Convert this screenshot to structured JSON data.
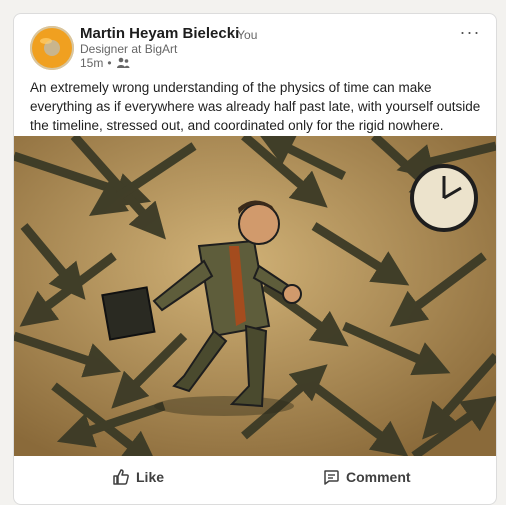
{
  "post": {
    "author_name": "Martin Heyam Bielecki",
    "you_tag": "· You",
    "headline": "Designer at BigArt",
    "time": "15m",
    "dot": "•",
    "visibility_icon": "connections-icon",
    "more_icon": "ellipsis-icon",
    "more_label": "···",
    "text": "An extremely wrong understanding of the physics of time can make everything as if everywhere was already half past late, with yourself outside the timeline, stressed out, and coordinated only for the rigid nowhere.",
    "image_icon": "illustration-man-running-late-arrows-clock"
  },
  "actions": {
    "like_label": "Like",
    "like_icon": "thumbs-up-icon",
    "comment_label": "Comment",
    "comment_icon": "comment-icon"
  },
  "colors": {
    "card_bg": "#ffffff",
    "page_bg": "#f3f2ef",
    "muted_text": "#666666",
    "image_bg": "#b08b4f",
    "arrow_dark": "#3b3a26"
  }
}
